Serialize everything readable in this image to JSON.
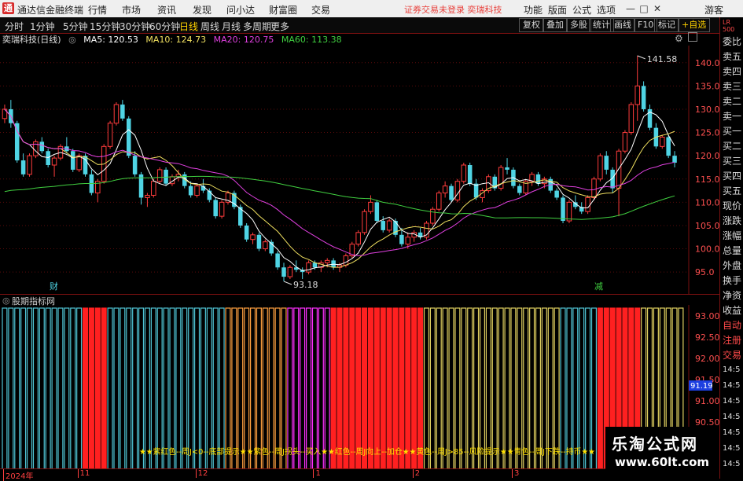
{
  "app": {
    "title": "通达信金融终端",
    "menu": [
      "行情",
      "市场",
      "资讯",
      "发现",
      "问小达",
      "财富圈",
      "交易"
    ],
    "warning": "证券交易未登录  奕瑞科技",
    "right_menu": [
      "功能",
      "版面",
      "公式",
      "选项"
    ],
    "guest": "游客",
    "window_buttons": {
      "min": "—",
      "max": "□",
      "close": "✕"
    }
  },
  "toolbar": {
    "periods": [
      "分时",
      "1分钟",
      "5分钟",
      "15分钟",
      "30分钟",
      "60分钟",
      "日线",
      "周线",
      "月线",
      "多周期",
      "更多"
    ],
    "active_period": "日线",
    "buttons": [
      "复权",
      "叠加",
      "多股",
      "统计",
      "画线",
      "F10",
      "标记",
      "+自选"
    ]
  },
  "stock": {
    "name": "奕瑞科技(日线)",
    "ma": [
      {
        "label": "MA5: 120.53",
        "color": "#ffffff"
      },
      {
        "label": "MA10: 124.73",
        "color": "#f0e060"
      },
      {
        "label": "MA20: 120.75",
        "color": "#e040e0"
      },
      {
        "label": "MA60: 113.38",
        "color": "#40d040"
      }
    ],
    "high_label": "141.58",
    "low_label": "93.18",
    "marker_cai": "财",
    "marker_jian": "减"
  },
  "price_axis": [
    "140.0",
    "135.0",
    "130.0",
    "125.0",
    "120.0",
    "115.0",
    "110.0",
    "105.0",
    "100.0",
    "95.0"
  ],
  "indicator": {
    "title": "股期指标网",
    "axis": [
      "93.00",
      "92.50",
      "92.00",
      "91.50",
      "91.00",
      "90.50"
    ],
    "current_value": "91.19",
    "legend_text": "★★紫红色--周J<0--底部提示★★紫色--周J拐头--买入★★红色--周J向上--加仓★★黄色--周J>85--风险提示★★青色--周J下跌--持币★★",
    "segments": [
      {
        "start": 0,
        "count": 13,
        "color": "#4fc4d4"
      },
      {
        "start": 13,
        "count": 4,
        "color": "#ff2020"
      },
      {
        "start": 17,
        "count": 19,
        "color": "#4fc4d4"
      },
      {
        "start": 36,
        "count": 10,
        "color": "#ffa040"
      },
      {
        "start": 46,
        "count": 7,
        "color": "#ff30ff"
      },
      {
        "start": 53,
        "count": 15,
        "color": "#ff2020"
      },
      {
        "start": 68,
        "count": 22,
        "color": "#e0d060"
      },
      {
        "start": 90,
        "count": 6,
        "color": "#4fc4d4"
      },
      {
        "start": 96,
        "count": 7,
        "color": "#ff2020"
      },
      {
        "start": 103,
        "count": 11,
        "color": "#e0d060"
      }
    ]
  },
  "timeline": [
    {
      "label": "2024年",
      "index": 0
    },
    {
      "label": "11",
      "index": 12
    },
    {
      "label": "12",
      "index": 31
    },
    {
      "label": "1",
      "index": 50
    },
    {
      "label": "2",
      "index": 66
    },
    {
      "label": "3",
      "index": 82
    },
    {
      "label": "4",
      "index": 101
    }
  ],
  "right_panel": {
    "top_badge": "LR 500",
    "labels": [
      "委比",
      "卖五",
      "卖四",
      "卖三",
      "卖二",
      "卖一",
      "买一",
      "买二",
      "买三",
      "买四",
      "买五",
      "现价",
      "涨跌",
      "涨幅",
      "总量",
      "外盘",
      "换手",
      "净资",
      "收益",
      "自动",
      "注册",
      "交易"
    ],
    "times": [
      "14:5",
      "14:5",
      "14:5",
      "14:5",
      "14:5",
      "14:5",
      "14:5"
    ]
  },
  "watermark": {
    "line1": "乐淘公式网",
    "line2": "www.60lt.com"
  },
  "colors": {
    "up": "#ff3c3c",
    "down": "#4fd4e4",
    "grid": "#7a1010",
    "axis_text": "#ff5050"
  },
  "chart_data": {
    "type": "candlestick",
    "y_range": [
      93,
      143
    ],
    "candles": [
      [
        128,
        131,
        127.0,
        130.0
      ],
      [
        130.0,
        132,
        126.0,
        127.0
      ],
      [
        127.0,
        127.5,
        118.5,
        119.0
      ],
      [
        119.0,
        120.5,
        115.5,
        116.0
      ],
      [
        116.0,
        120.5,
        115.5,
        120.0
      ],
      [
        120.0,
        123.5,
        119.5,
        123.0
      ],
      [
        123.0,
        124.0,
        120.5,
        121.0
      ],
      [
        121.0,
        121.5,
        117.5,
        118.0
      ],
      [
        118.0,
        120.0,
        115.5,
        119.5
      ],
      [
        119.5,
        122.5,
        119.0,
        122.0
      ],
      [
        122.0,
        124.0,
        120.5,
        121.0
      ],
      [
        121.0,
        121.5,
        116.5,
        117.0
      ],
      [
        117.0,
        120.5,
        116.5,
        120.0
      ],
      [
        120.0,
        120.5,
        115.5,
        116.0
      ],
      [
        116.0,
        117.0,
        111.5,
        112.0
      ],
      [
        112.0,
        115.0,
        110.0,
        114.5
      ],
      [
        114.5,
        122.5,
        114.0,
        122.0
      ],
      [
        122.0,
        127.5,
        121.5,
        127.0
      ],
      [
        127.0,
        131.5,
        126.5,
        131.0
      ],
      [
        131.0,
        132.0,
        127.5,
        128.0
      ],
      [
        128.0,
        128.5,
        119.5,
        120.0
      ],
      [
        120.0,
        121.0,
        115.5,
        116.0
      ],
      [
        116.0,
        116.5,
        109.5,
        111.0
      ],
      [
        111.0,
        112.0,
        109.0,
        111.5
      ],
      [
        111.5,
        115.0,
        111.0,
        114.5
      ],
      [
        114.5,
        117.5,
        114.0,
        117.0
      ],
      [
        117.0,
        117.5,
        113.5,
        114.0
      ],
      [
        114.0,
        116.0,
        113.5,
        115.5
      ],
      [
        115.5,
        117.0,
        114.5,
        116.0
      ],
      [
        116.0,
        116.5,
        113.0,
        113.5
      ],
      [
        113.5,
        114.5,
        111.0,
        111.5
      ],
      [
        111.5,
        114.0,
        111.0,
        113.5
      ],
      [
        113.5,
        115.0,
        112.0,
        112.5
      ],
      [
        112.5,
        113.0,
        110.0,
        110.5
      ],
      [
        110.5,
        111.0,
        106.5,
        107.0
      ],
      [
        107.0,
        110.5,
        106.5,
        110.0
      ],
      [
        110.0,
        112.5,
        109.5,
        112.0
      ],
      [
        112.0,
        112.5,
        108.5,
        109.0
      ],
      [
        109.0,
        109.5,
        104.5,
        105.0
      ],
      [
        105.0,
        105.5,
        101.5,
        102.0
      ],
      [
        102.0,
        103.5,
        101.0,
        103.0
      ],
      [
        103.0,
        103.5,
        99.5,
        100.0
      ],
      [
        100.0,
        102.0,
        99.5,
        101.5
      ],
      [
        101.5,
        102.0,
        98.5,
        99.0
      ],
      [
        99.0,
        99.5,
        95.5,
        96.0
      ],
      [
        96.0,
        97.0,
        93.0,
        94.0
      ],
      [
        94.0,
        96.5,
        93.5,
        96.0
      ],
      [
        96.0,
        97.5,
        95.0,
        95.5
      ],
      [
        95.5,
        96.0,
        93.5,
        95.0
      ],
      [
        95.0,
        97.5,
        94.5,
        97.0
      ],
      [
        97.0,
        97.5,
        95.5,
        96.0
      ],
      [
        96.0,
        97.5,
        95.0,
        97.0
      ],
      [
        97.0,
        98.0,
        96.0,
        97.5
      ],
      [
        97.5,
        98.0,
        95.5,
        96.0
      ],
      [
        96.0,
        97.0,
        95.0,
        96.5
      ],
      [
        96.5,
        99.0,
        96.0,
        98.5
      ],
      [
        98.5,
        101.5,
        98.0,
        101.0
      ],
      [
        101.0,
        104.0,
        100.5,
        103.5
      ],
      [
        103.5,
        108.5,
        103.0,
        108.0
      ],
      [
        108.0,
        111.5,
        107.5,
        110.0
      ],
      [
        110.0,
        110.5,
        105.5,
        106.0
      ],
      [
        106.0,
        107.0,
        103.5,
        104.0
      ],
      [
        104.0,
        106.5,
        103.5,
        106.0
      ],
      [
        106.0,
        106.5,
        102.5,
        103.0
      ],
      [
        103.0,
        104.5,
        100.5,
        101.0
      ],
      [
        101.0,
        103.5,
        100.0,
        102.5
      ],
      [
        102.5,
        104.0,
        101.5,
        103.5
      ],
      [
        103.5,
        104.5,
        102.0,
        102.5
      ],
      [
        102.5,
        106.0,
        102.0,
        105.5
      ],
      [
        105.5,
        109.0,
        105.0,
        108.5
      ],
      [
        108.5,
        112.5,
        108.0,
        112.0
      ],
      [
        112.0,
        114.5,
        111.0,
        113.5
      ],
      [
        113.5,
        114.0,
        110.0,
        110.5
      ],
      [
        110.5,
        115.0,
        110.0,
        114.5
      ],
      [
        114.5,
        118.5,
        114.0,
        118.0
      ],
      [
        118.0,
        118.5,
        113.5,
        114.0
      ],
      [
        114.0,
        115.0,
        110.5,
        111.0
      ],
      [
        111.0,
        113.0,
        110.0,
        112.5
      ],
      [
        112.5,
        116.0,
        112.0,
        115.5
      ],
      [
        115.5,
        116.0,
        112.5,
        113.0
      ],
      [
        113.0,
        118.0,
        112.5,
        117.5
      ],
      [
        117.5,
        119.5,
        116.0,
        117.0
      ],
      [
        117.0,
        117.5,
        113.0,
        113.5
      ],
      [
        113.5,
        114.0,
        111.5,
        112.0
      ],
      [
        112.0,
        115.0,
        111.5,
        114.5
      ],
      [
        114.5,
        116.5,
        113.5,
        116.0
      ],
      [
        116.0,
        116.5,
        113.5,
        114.0
      ],
      [
        114.0,
        115.5,
        113.0,
        115.0
      ],
      [
        115.0,
        115.5,
        112.0,
        112.5
      ],
      [
        112.5,
        113.0,
        110.5,
        111.0
      ],
      [
        111.0,
        111.5,
        105.5,
        106.0
      ],
      [
        106.0,
        110.5,
        105.5,
        110.0
      ],
      [
        110.0,
        111.5,
        108.5,
        109.0
      ],
      [
        109.0,
        110.0,
        107.5,
        108.0
      ],
      [
        108.0,
        111.5,
        107.5,
        111.0
      ],
      [
        111.0,
        115.5,
        110.5,
        115.0
      ],
      [
        115.0,
        120.5,
        114.5,
        120.0
      ],
      [
        120.0,
        121.0,
        116.0,
        117.0
      ],
      [
        117.0,
        117.5,
        112.0,
        113.0
      ],
      [
        113.0,
        121.5,
        107.0,
        121.0
      ],
      [
        121.0,
        125.5,
        120.5,
        125.0
      ],
      [
        125.0,
        131.5,
        124.5,
        131.0
      ],
      [
        131.0,
        141.5,
        127.5,
        135.0
      ],
      [
        135.0,
        136.0,
        129.5,
        130.0
      ],
      [
        130.0,
        131.0,
        125.5,
        126.0
      ],
      [
        126.0,
        127.0,
        121.5,
        122.0
      ],
      [
        122.0,
        124.5,
        121.5,
        124.0
      ],
      [
        124.0,
        124.5,
        119.5,
        120.0
      ],
      [
        120.0,
        121.0,
        117.5,
        118.5
      ]
    ]
  }
}
